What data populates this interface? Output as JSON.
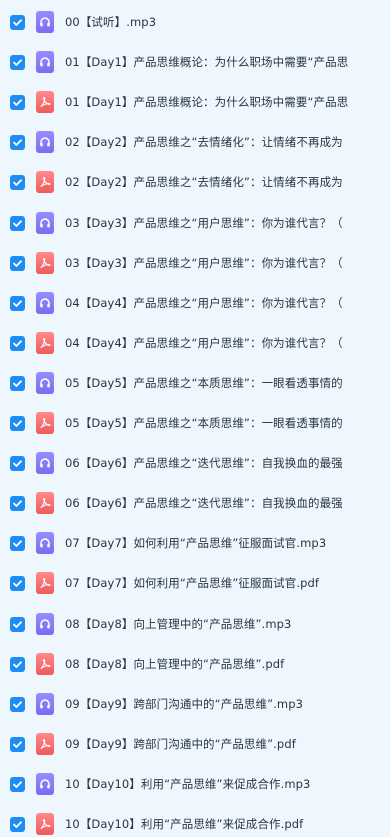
{
  "files": [
    {
      "name": "00【试听】.mp3",
      "type": "audio-icon",
      "checked": true
    },
    {
      "name": "01【Day1】产品思维概论：为什么职场中需要“产品思",
      "type": "audio-icon",
      "checked": true
    },
    {
      "name": "01【Day1】产品思维概论：为什么职场中需要“产品思",
      "type": "pdf-icon",
      "checked": true
    },
    {
      "name": "02【Day2】产品思维之“去情绪化”：让情绪不再成为",
      "type": "audio-icon",
      "checked": true
    },
    {
      "name": "02【Day2】产品思维之“去情绪化”：让情绪不再成为",
      "type": "pdf-icon",
      "checked": true
    },
    {
      "name": "03【Day3】产品思维之“用户思维”：你为谁代言？（",
      "type": "audio-icon",
      "checked": true
    },
    {
      "name": "03【Day3】产品思维之“用户思维”：你为谁代言？（",
      "type": "pdf-icon",
      "checked": true
    },
    {
      "name": "04【Day4】产品思维之“用户思维”：你为谁代言？（",
      "type": "audio-icon",
      "checked": true
    },
    {
      "name": "04【Day4】产品思维之“用户思维”：你为谁代言？（",
      "type": "pdf-icon",
      "checked": true
    },
    {
      "name": "05【Day5】产品思维之“本质思维”：一眼看透事情的",
      "type": "audio-icon",
      "checked": true
    },
    {
      "name": "05【Day5】产品思维之“本质思维”：一眼看透事情的",
      "type": "pdf-icon",
      "checked": true
    },
    {
      "name": "06【Day6】产品思维之“迭代思维”：自我换血的最强",
      "type": "audio-icon",
      "checked": true
    },
    {
      "name": "06【Day6】产品思维之“迭代思维”：自我换血的最强",
      "type": "pdf-icon",
      "checked": true
    },
    {
      "name": "07【Day7】如何利用“产品思维”征服面试官.mp3",
      "type": "audio-icon",
      "checked": true
    },
    {
      "name": "07【Day7】如何利用“产品思维”征服面试官.pdf",
      "type": "pdf-icon",
      "checked": true
    },
    {
      "name": "08【Day8】向上管理中的“产品思维”.mp3",
      "type": "audio-icon",
      "checked": true
    },
    {
      "name": "08【Day8】向上管理中的“产品思维”.pdf",
      "type": "pdf-icon",
      "checked": true
    },
    {
      "name": "09【Day9】跨部门沟通中的“产品思维”.mp3",
      "type": "audio-icon",
      "checked": true
    },
    {
      "name": "09【Day9】跨部门沟通中的“产品思维”.pdf",
      "type": "pdf-icon",
      "checked": true
    },
    {
      "name": "10【Day10】利用“产品思维”来促成合作.mp3",
      "type": "audio-icon",
      "checked": true
    },
    {
      "name": "10【Day10】利用“产品思维”来促成合作.pdf",
      "type": "pdf-icon",
      "checked": true
    }
  ],
  "colors": {
    "background": "#eef7fe",
    "checkbox": "#1e8cf3",
    "audio_icon": "#8a7af7",
    "pdf_icon": "#f46a6a",
    "text": "#2a3442"
  }
}
